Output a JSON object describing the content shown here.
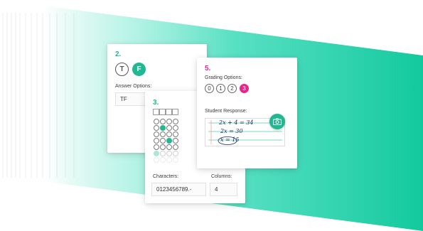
{
  "colors": {
    "accent_green": "#1fb891",
    "accent_pink": "#e8248b"
  },
  "card_q2": {
    "number": "2.",
    "true_label": "T",
    "false_label": "F",
    "answer_options_label": "Answer Options:",
    "answer_options_value": "TF"
  },
  "card_q3": {
    "number": "3.",
    "characters_label": "Characters:",
    "characters_value": "0123456789.-",
    "columns_label": "Columns:",
    "columns_value": "4"
  },
  "card_q5": {
    "number": "5.",
    "grading_options_label": "Grading Options:",
    "grades": [
      "0",
      "1",
      "2",
      "3"
    ],
    "selected_grade": "3",
    "student_response_label": "Student Response:",
    "camera_icon": "camera-icon",
    "handwriting_lines": [
      "2x + 4 = 34",
      "2x = 30",
      "x = 15"
    ]
  }
}
